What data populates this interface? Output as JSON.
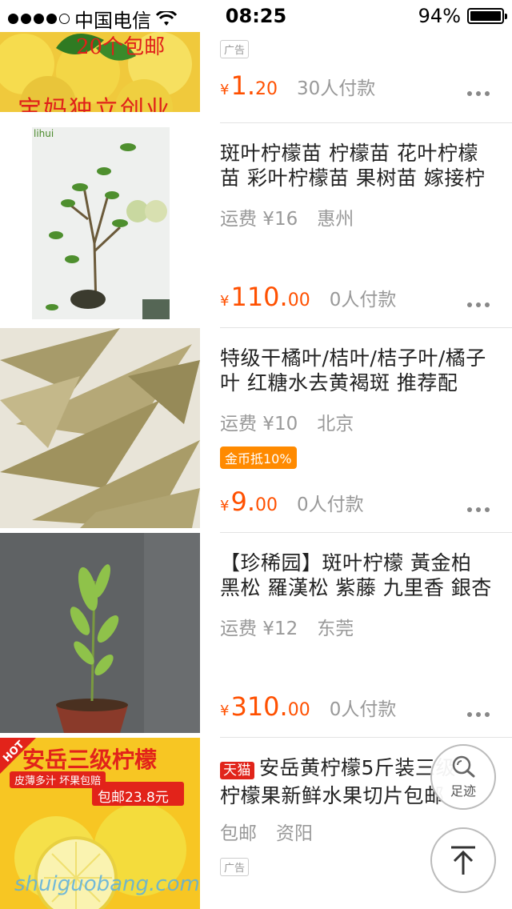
{
  "status": {
    "carrier": "中国电信",
    "time": "08:25",
    "battery": "94%",
    "battery_level": 0.94
  },
  "items": [
    {
      "title": "",
      "ad_label": "广告",
      "price_currency": "¥",
      "price_int": "1.",
      "price_dec": "20",
      "sold": "30人付款",
      "banner_text_top": "20个包邮",
      "banner_text_bottom": "宝妈独立创业"
    },
    {
      "title": "斑叶柠檬苗 柠檬苗 花叶柠檬苗 彩叶柠檬苗 果树苗 嫁接柠",
      "shipping": "运费 ¥16",
      "location": "惠州",
      "price_currency": "¥",
      "price_int": "110.",
      "price_dec": "00",
      "sold": "0人付款",
      "thumb_logo": "lihui"
    },
    {
      "title": "特级干橘叶/桔叶/桔子叶/橘子叶 红糖水去黄褐斑 推荐配",
      "shipping": "运费 ¥10",
      "location": "北京",
      "coin_tag": "金币抵10%",
      "price_currency": "¥",
      "price_int": "9.",
      "price_dec": "00",
      "sold": "0人付款"
    },
    {
      "title": "【珍稀园】斑叶柠檬 黃金柏 黑松 羅漢松 紫藤  九里香 銀杏",
      "shipping": "运费 ¥12",
      "location": "东莞",
      "price_currency": "¥",
      "price_int": "310.",
      "price_dec": "00",
      "sold": "0人付款"
    },
    {
      "tmall_tag": "天猫",
      "title": "安岳黄柠檬5斤装三级柠檬果新鲜水果切片包邮",
      "shipping": "包邮",
      "location": "资阳",
      "ad_label": "广告",
      "banner_title": "安岳三级柠檬",
      "banner_hot": "HOT",
      "banner_sub": "皮薄多汁 坏果包赔",
      "banner_price": "包邮23.8元",
      "watermark": "shuiguobang.com"
    }
  ],
  "fab": {
    "footprint_label": "足迹"
  },
  "colors": {
    "price": "#ff5000",
    "coin_tag": "#ff8a00",
    "tmall": "#e1251b"
  }
}
